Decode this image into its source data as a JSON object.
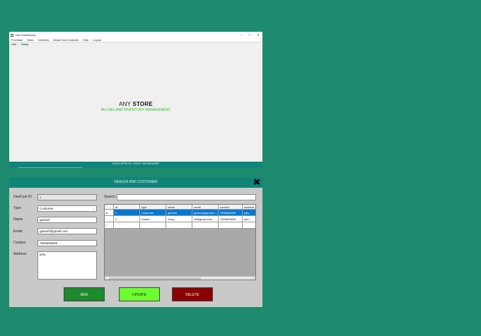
{
  "dashboard": {
    "window_title": "User Dashboard",
    "window_controls": [
      "–",
      "□",
      "✕"
    ],
    "menu": [
      "Purchase",
      "Sales",
      "Inventory",
      "Dealer And Customer",
      "Help",
      "Logout"
    ],
    "subbar": {
      "user_label": "User :",
      "user_value": "Udaay"
    },
    "store_prefix": "ANY ",
    "store_bold": "STORE",
    "subtitle": "BILLING AND INVENTORY MANAGEMENT",
    "footer": "DEVELOPED BY : ROHIT MAHISHWARE"
  },
  "dialog": {
    "title": "DEALER AND CUSTOMER",
    "close_glyph": "✖",
    "labels": {
      "id": "DeaCust ID",
      "type": "Type",
      "name": "Name",
      "email": "Email",
      "contact": "Contact",
      "address": "Address",
      "search": "Search"
    },
    "values": {
      "id": "1",
      "type": "Customer",
      "name": "ganesh",
      "email": "ganesh@gmail.com",
      "contact": "7506668909",
      "address": "juhu",
      "search": ""
    },
    "combo_arrow": "⌄",
    "grid": {
      "columns": [
        "id",
        "type",
        "name",
        "email",
        "contact",
        "address"
      ],
      "rows": [
        {
          "marker": "▸",
          "cells": [
            "1",
            "Customer",
            "ganesh",
            "ganesh@gmail.c...",
            "7505668909",
            "juhu"
          ]
        },
        {
          "marker": "",
          "cells": [
            "2",
            "Dealer",
            "vinay",
            "vk@gmail.com",
            "7505669826",
            "juhu"
          ]
        },
        {
          "marker": "*",
          "cells": [
            "",
            "",
            "",
            "",
            "",
            ""
          ]
        }
      ],
      "scroll_left": "‹",
      "scroll_right": "›"
    },
    "buttons": {
      "add": "ADD",
      "update": "UPDATE",
      "delete": "DELETE"
    }
  }
}
